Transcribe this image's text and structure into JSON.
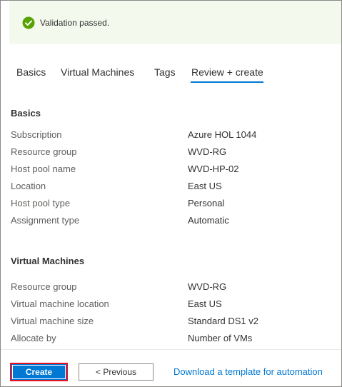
{
  "banner": {
    "message": "Validation passed.",
    "icon": "checkmark-circle-icon",
    "color": "#57a300",
    "background": "#f4f9ee"
  },
  "tabs": [
    {
      "label": "Basics",
      "active": false
    },
    {
      "label": "Virtual Machines",
      "active": false
    },
    {
      "label": "Tags",
      "active": false
    },
    {
      "label": "Review + create",
      "active": true
    }
  ],
  "basics": {
    "title": "Basics",
    "rows": [
      {
        "label": "Subscription",
        "value": "Azure HOL 1044"
      },
      {
        "label": "Resource group",
        "value": "WVD-RG"
      },
      {
        "label": "Host pool name",
        "value": "WVD-HP-02"
      },
      {
        "label": "Location",
        "value": "East US"
      },
      {
        "label": "Host pool type",
        "value": "Personal"
      },
      {
        "label": "Assignment type",
        "value": "Automatic"
      }
    ]
  },
  "virtual_machines": {
    "title": "Virtual Machines",
    "rows": [
      {
        "label": "Resource group",
        "value": "WVD-RG"
      },
      {
        "label": "Virtual machine location",
        "value": "East US"
      },
      {
        "label": "Virtual machine size",
        "value": "Standard DS1 v2"
      },
      {
        "label": "Allocate by",
        "value": "Number of VMs"
      }
    ]
  },
  "footer": {
    "create_label": "Create",
    "previous_label": "< Previous",
    "download_link": "Download a template for automation"
  },
  "colors": {
    "accent": "#0078d4",
    "highlight_border": "#e81123"
  }
}
